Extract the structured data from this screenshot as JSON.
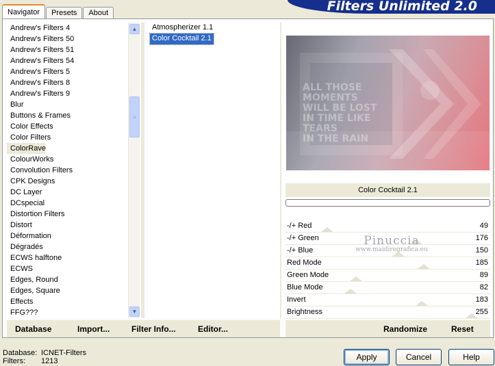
{
  "tabs": [
    "Navigator",
    "Presets",
    "About"
  ],
  "banner": "Filters Unlimited 2.0",
  "categories": [
    "Andrew's Filters 4",
    "Andrew's Filters 50",
    "Andrew's Filters 51",
    "Andrew's Filters 54",
    "Andrew's Filters 5",
    "Andrew's Filters 8",
    "Andrew's Filters 9",
    "Blur",
    "Buttons & Frames",
    "Color Effects",
    "Color Filters",
    "ColorRave",
    "ColourWorks",
    "Convolution Filters",
    "CPK Designs",
    "DC Layer",
    "DCspecial",
    "Distortion Filters",
    "Distort",
    "Déformation",
    "Dégradés",
    "ECWS halftone",
    "ECWS",
    "Edges, Round",
    "Edges, Square",
    "Effects",
    "FFG???"
  ],
  "selected_category": "ColorRave",
  "filters": [
    "Atmospherizer 1.1",
    "Color Cocktail 2.1"
  ],
  "selected_filter": "Color Cocktail 2.1",
  "preview": {
    "filter_name": "Color Cocktail 2.1",
    "image_text": "ALL THOSE MOMENTS WILL BE LOST IN TIME LIKE TEARS IN THE RAIN"
  },
  "params": [
    {
      "name": "-/+ Red",
      "value": "49",
      "fraction": 0.19
    },
    {
      "name": "-/+ Green",
      "value": "176",
      "fraction": 0.69
    },
    {
      "name": "-/+ Blue",
      "value": "150",
      "fraction": 0.59
    },
    {
      "name": "Red Mode",
      "value": "185",
      "fraction": 0.73
    },
    {
      "name": "Green Mode",
      "value": "89",
      "fraction": 0.35
    },
    {
      "name": "Blue Mode",
      "value": "82",
      "fraction": 0.32
    },
    {
      "name": "Invert",
      "value": "183",
      "fraction": 0.72
    },
    {
      "name": "Brightness",
      "value": "255",
      "fraction": 1.0
    }
  ],
  "watermark": {
    "name": "Pinuccia",
    "url": "www.maidiregrafica.eu"
  },
  "toolbar_left": [
    "Database",
    "Import...",
    "Filter Info...",
    "Editor..."
  ],
  "toolbar_right": [
    "Randomize",
    "Reset"
  ],
  "status": {
    "database_label": "Database:",
    "database_value": "ICNET-Filters",
    "filters_label": "Filters:",
    "filters_value": "1213"
  },
  "buttons": {
    "apply": "Apply",
    "cancel": "Cancel",
    "help": "Help"
  }
}
